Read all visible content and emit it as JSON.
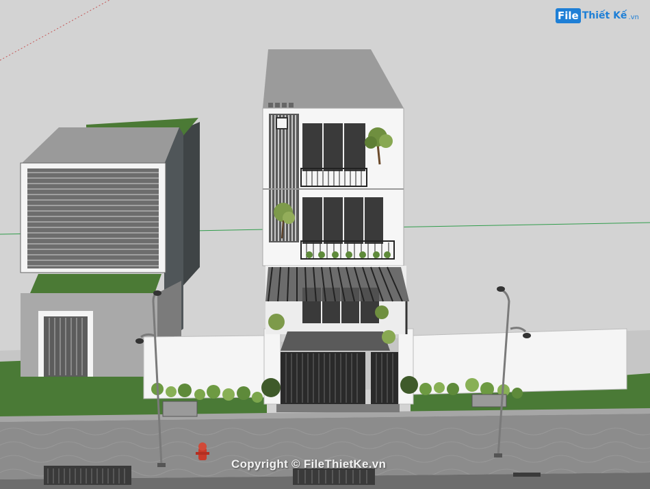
{
  "image": {
    "kind": "3D architectural model render (townhouse with street)",
    "colors": {
      "sky": "#d6d6d6",
      "ground": "#c4c4c4",
      "grass": "#4e7d3a",
      "pavement": "#8a8a8a",
      "wall_white": "#f4f4f4",
      "dark_glass": "#3b3b3b",
      "logo_blue": "#1e7fd6"
    }
  },
  "watermark": {
    "logo_box": "File",
    "logo_name": "Thiết Kế",
    "logo_tld": ".vn",
    "copyright": "Copyright © FileThietKe.vn"
  }
}
